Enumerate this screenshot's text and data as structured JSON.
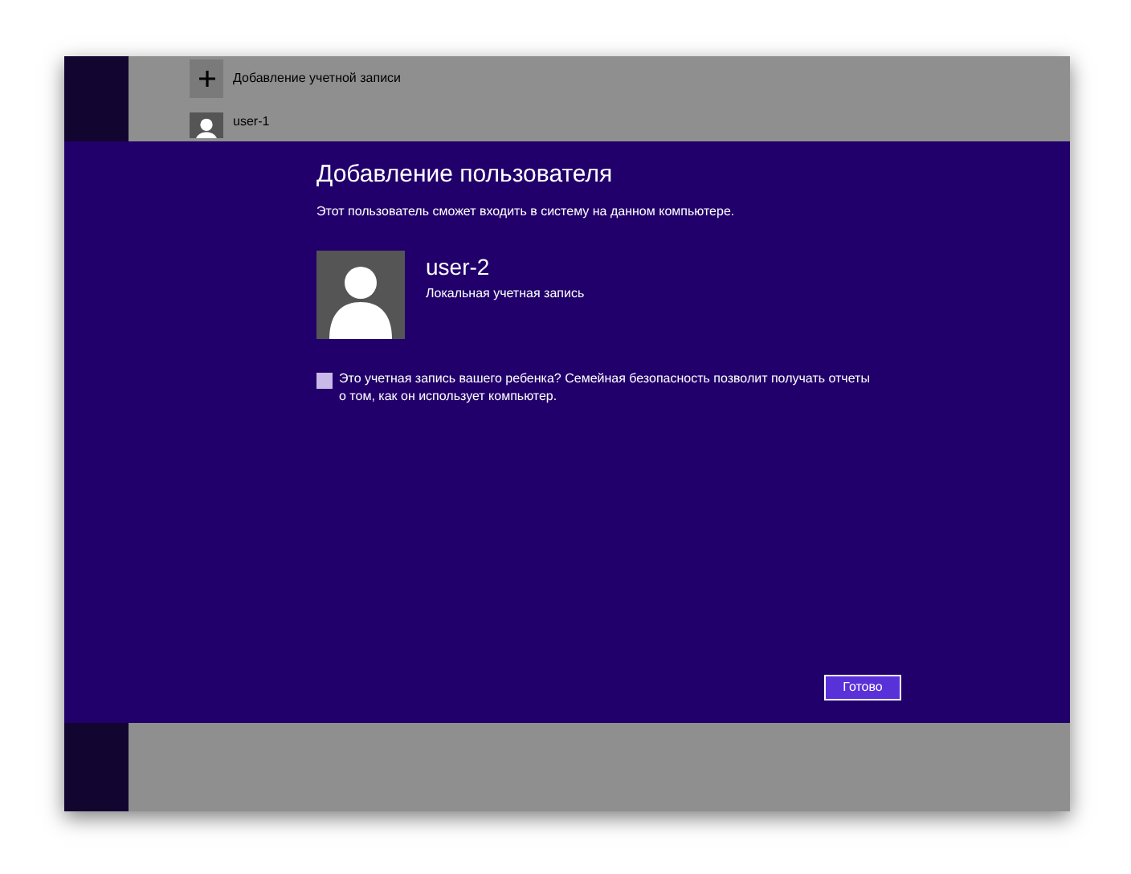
{
  "account_list": {
    "items": [
      {
        "kind": "add",
        "label": "Добавление учетной записи"
      },
      {
        "kind": "user",
        "label": "user-1"
      }
    ]
  },
  "dialog": {
    "title": "Добавление пользователя",
    "subtitle": "Этот пользователь сможет входить в систему на данном компьютере.",
    "user": {
      "name": "user-2",
      "type": "Локальная учетная запись"
    },
    "child_account": {
      "checked": false,
      "label": "Это учетная запись вашего ребенка? Семейная безопасность позволит получать отчеты о том, как он использует компьютер."
    },
    "button": "Готово"
  }
}
